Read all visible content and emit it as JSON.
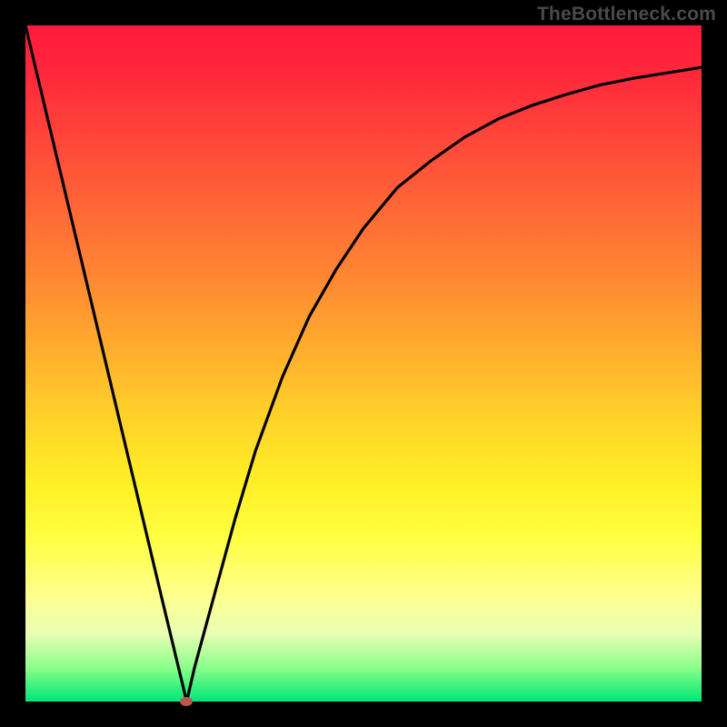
{
  "watermark": "TheBottleneck.com",
  "colors": {
    "frame": "#000000",
    "curve": "#000000",
    "marker": "#b9564e"
  },
  "chart_data": {
    "type": "line",
    "title": "",
    "xlabel": "",
    "ylabel": "",
    "x": [
      0.0,
      0.05,
      0.1,
      0.15,
      0.2,
      0.2385,
      0.25,
      0.28,
      0.31,
      0.34,
      0.38,
      0.42,
      0.46,
      0.5,
      0.55,
      0.6,
      0.65,
      0.7,
      0.75,
      0.8,
      0.85,
      0.9,
      0.95,
      1.0
    ],
    "values": [
      1.0,
      0.79,
      0.58,
      0.37,
      0.16,
      0.0,
      0.05,
      0.16,
      0.27,
      0.37,
      0.48,
      0.57,
      0.64,
      0.7,
      0.76,
      0.8,
      0.835,
      0.862,
      0.882,
      0.898,
      0.912,
      0.922,
      0.93,
      0.938
    ],
    "xlim": [
      0,
      1
    ],
    "ylim": [
      0,
      1
    ],
    "marker": {
      "x": 0.2385,
      "y": 0.0
    },
    "annotations": []
  }
}
